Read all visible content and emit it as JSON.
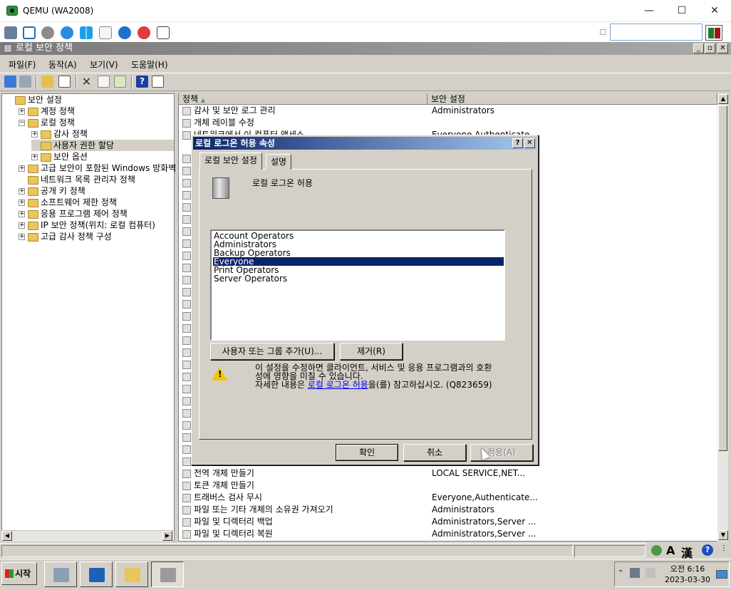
{
  "host": {
    "title": "QEMU (WA2008)",
    "window_buttons": [
      "—",
      "☐",
      "✕"
    ],
    "search_value": ""
  },
  "mmc": {
    "title": "로컬 보안 정책",
    "mdi_buttons": [
      "_",
      "▫",
      "✕"
    ],
    "menus": [
      "파일(F)",
      "동작(A)",
      "보기(V)",
      "도움말(H)"
    ],
    "tree": [
      {
        "label": "보안 설정",
        "expander": "",
        "indent": 0
      },
      {
        "label": "계정 정책",
        "expander": "+",
        "indent": 1
      },
      {
        "label": "로컬 정책",
        "expander": "−",
        "indent": 1
      },
      {
        "label": "감사 정책",
        "expander": "+",
        "indent": 2
      },
      {
        "label": "사용자 권한 할당",
        "expander": "",
        "indent": 2,
        "selected": true
      },
      {
        "label": "보안 옵션",
        "expander": "+",
        "indent": 2
      },
      {
        "label": "고급 보안이 포함된 Windows 방화벽",
        "expander": "+",
        "indent": 1
      },
      {
        "label": "네트워크 목록 관리자 정책",
        "expander": "",
        "indent": 1
      },
      {
        "label": "공개 키 정책",
        "expander": "+",
        "indent": 1
      },
      {
        "label": "소프트웨어 제한 정책",
        "expander": "+",
        "indent": 1
      },
      {
        "label": "응용 프로그램 제어 정책",
        "expander": "+",
        "indent": 1
      },
      {
        "label": "IP 보안 정책(위치: 로컬 컴퓨터)",
        "expander": "+",
        "indent": 1
      },
      {
        "label": "고급 감사 정책 구성",
        "expander": "+",
        "indent": 1
      }
    ],
    "columns": [
      "정책",
      "보안 설정"
    ],
    "rows_top": [
      {
        "policy": "감사 및 보안 로그 관리",
        "setting": "Administrators"
      },
      {
        "policy": "개체 레이블 수정",
        "setting": ""
      },
      {
        "policy": "네트워크에서 이 컴퓨터 액세스",
        "setting": "Everyone,Authenticate..."
      }
    ],
    "rows_bottom": [
      {
        "policy": "전역 개체 만들기",
        "setting": "LOCAL SERVICE,NET..."
      },
      {
        "policy": "토큰 개체 만들기",
        "setting": ""
      },
      {
        "policy": "트래버스 검사 무시",
        "setting": "Everyone,Authenticate..."
      },
      {
        "policy": "파일 또는 기타 개체의 소유권 가져오기",
        "setting": "Administrators"
      },
      {
        "policy": "파일 및 디렉터리 백업",
        "setting": "Administrators,Server ..."
      },
      {
        "policy": "파일 및 디렉터리 복원",
        "setting": "Administrators,Server ..."
      }
    ]
  },
  "dialog": {
    "title": "로컬 로그온 허용 속성",
    "help_button": "?",
    "close_button": "✕",
    "tabs": [
      "로컬 보안 설정",
      "설명"
    ],
    "policy_name": "로컬 로그온 허용",
    "groups": [
      "Account Operators",
      "Administrators",
      "Backup Operators",
      "Everyone",
      "Print Operators",
      "Server Operators"
    ],
    "selected_group": "Everyone",
    "add_button": "사용자 또는 그룹 추가(U)...",
    "remove_button": "제거(R)",
    "warning_line1": "이 설정을 수정하면 클라이언트, 서비스 및 응용 프로그램과의 호환",
    "warning_line2": "성에 영향을 미칠 수 있습니다.",
    "warning_line3_pre": "자세한 내용은 ",
    "warning_link": "로컬 로그온 허용",
    "warning_line3_post": "을(를) 참고하십시오. (Q823659)",
    "ok_button": "확인",
    "cancel_button": "취소",
    "apply_button": "적용(A)"
  },
  "status": {
    "ime_a": "A",
    "ime_han": "漢",
    "help": "?"
  },
  "taskbar": {
    "start": "시작",
    "clock_time": "오전 6:16",
    "clock_date": "2023-03-30"
  }
}
